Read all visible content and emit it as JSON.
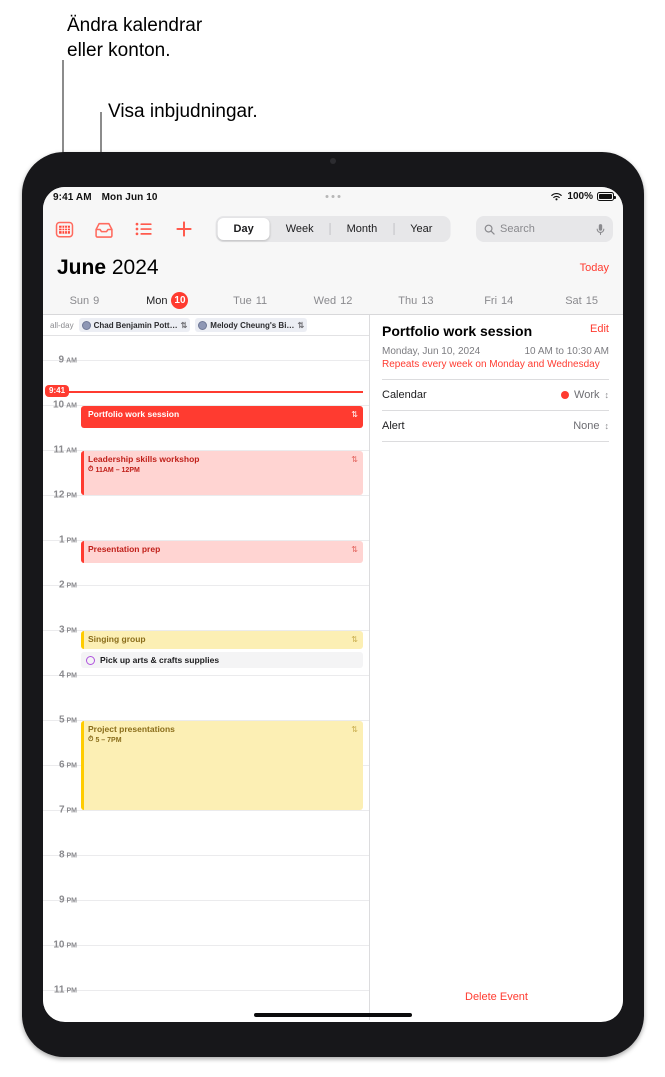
{
  "callouts": [
    {
      "text": "Ändra kalendrar\neller konton.",
      "target": "calendars-button"
    },
    {
      "text": "Visa inbjudningar.",
      "target": "inbox-button"
    }
  ],
  "statusbar": {
    "time": "9:41 AM",
    "date": "Mon Jun 10",
    "battery_percent": "100%",
    "wifi_icon": "wifi-icon",
    "battery_icon": "battery-icon"
  },
  "toolbar": {
    "icons": [
      {
        "name": "calendars-icon",
        "label": "Calendars"
      },
      {
        "name": "inbox-icon",
        "label": "Inbox"
      },
      {
        "name": "list-icon",
        "label": "List"
      },
      {
        "name": "add-icon",
        "label": "Add"
      }
    ],
    "segments": [
      {
        "label": "Day",
        "selected": true
      },
      {
        "label": "Week",
        "selected": false
      },
      {
        "label": "Month",
        "selected": false
      },
      {
        "label": "Year",
        "selected": false
      }
    ],
    "search": {
      "placeholder": "Search",
      "search_icon": "search-icon",
      "mic_icon": "microphone-icon"
    }
  },
  "header": {
    "month": "June",
    "year": "2024",
    "today_label": "Today"
  },
  "weekdays": [
    {
      "name": "Sun",
      "num": "9",
      "selected": false
    },
    {
      "name": "Mon",
      "num": "10",
      "selected": true
    },
    {
      "name": "Tue",
      "num": "11",
      "selected": false
    },
    {
      "name": "Wed",
      "num": "12",
      "selected": false
    },
    {
      "name": "Thu",
      "num": "13",
      "selected": false
    },
    {
      "name": "Fri",
      "num": "14",
      "selected": false
    },
    {
      "name": "Sat",
      "num": "15",
      "selected": false
    }
  ],
  "allday": {
    "label": "all-day",
    "events": [
      {
        "title": "Chad Benjamin Pott…",
        "repeat_icon": "repeat-icon"
      },
      {
        "title": "Melody Cheung's Bi…",
        "repeat_icon": "repeat-icon"
      }
    ]
  },
  "timeline": {
    "hours": [
      {
        "label": "9",
        "suffix": "AM"
      },
      {
        "label": "10",
        "suffix": "AM"
      },
      {
        "label": "11",
        "suffix": "AM"
      },
      {
        "label": "12",
        "suffix": "PM"
      },
      {
        "label": "1",
        "suffix": "PM"
      },
      {
        "label": "2",
        "suffix": "PM"
      },
      {
        "label": "3",
        "suffix": "PM"
      },
      {
        "label": "4",
        "suffix": "PM"
      },
      {
        "label": "5",
        "suffix": "PM"
      },
      {
        "label": "6",
        "suffix": "PM"
      },
      {
        "label": "7",
        "suffix": "PM"
      },
      {
        "label": "8",
        "suffix": "PM"
      },
      {
        "label": "9",
        "suffix": "PM"
      },
      {
        "label": "10",
        "suffix": "PM"
      },
      {
        "label": "11",
        "suffix": "PM"
      }
    ],
    "now_indicator": {
      "time": "9:41"
    },
    "events": [
      {
        "title": "Portfolio work session",
        "time": "",
        "style": "solid",
        "repeat_icon": "repeat-icon"
      },
      {
        "title": "Leadership skills workshop",
        "time": "11AM – 12PM",
        "style": "redlight",
        "repeat_icon": "repeat-icon"
      },
      {
        "title": "Presentation prep",
        "time": "",
        "style": "redlight",
        "repeat_icon": "repeat-icon"
      },
      {
        "title": "Singing group",
        "time": "",
        "style": "yellow",
        "repeat_icon": "repeat-icon"
      },
      {
        "title": "Project presentations",
        "time": "5 – 7PM",
        "style": "yellow",
        "repeat_icon": "repeat-icon"
      }
    ],
    "reminder": {
      "title": "Pick up arts & crafts supplies",
      "circle_icon": "reminder-circle-icon"
    }
  },
  "detail": {
    "title": "Portfolio work session",
    "edit_label": "Edit",
    "date": "Monday, Jun 10, 2024",
    "time_range": "10 AM to 10:30 AM",
    "repeat": "Repeats every week on Monday and Wednesday",
    "rows": [
      {
        "label": "Calendar",
        "value": "Work",
        "has_dot": true,
        "dot_color": "#ff3b30"
      },
      {
        "label": "Alert",
        "value": "None",
        "has_dot": false,
        "dot_color": ""
      }
    ],
    "delete_label": "Delete Event"
  },
  "colors": {
    "accent": "#ff3b30",
    "work_calendar": "#ff3b30",
    "yellow_calendar": "#ffcc00",
    "reminder_purple": "#af52de"
  }
}
